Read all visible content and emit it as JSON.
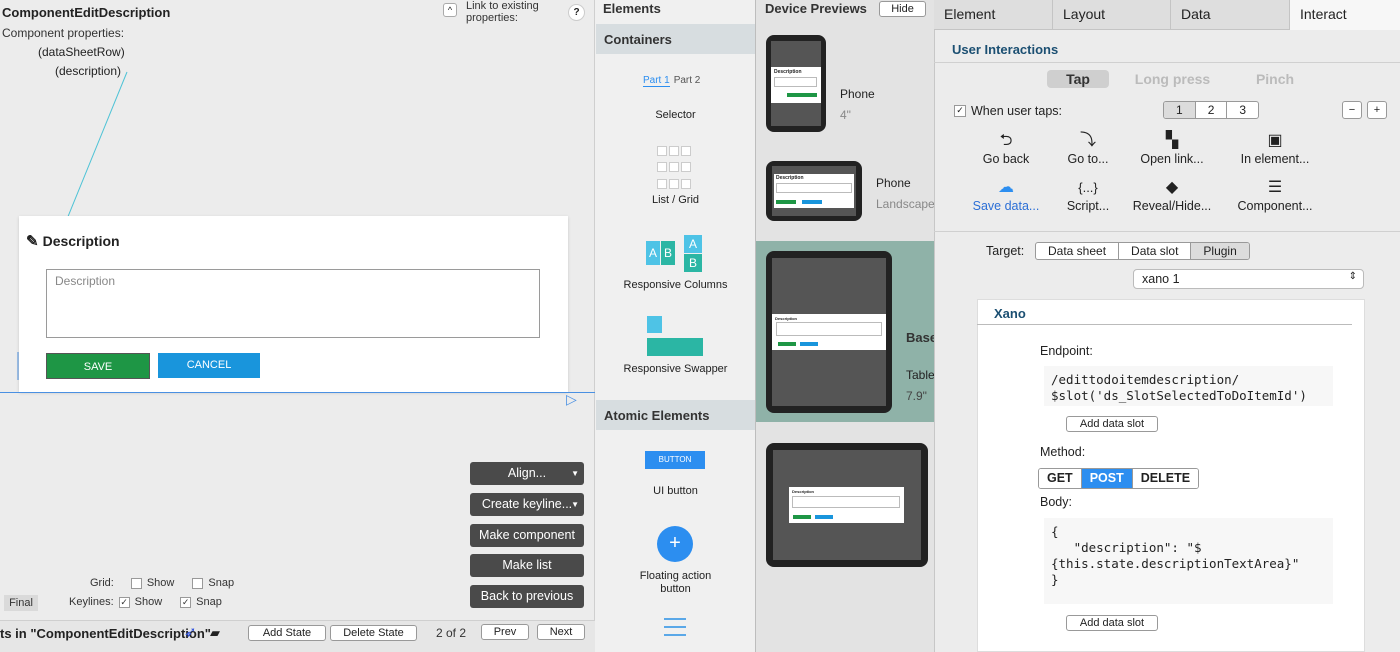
{
  "canvas": {
    "component_title": "ComponentEditDescription",
    "props_label": "Component properties:",
    "prop_lines": [
      "(dataSheetRow)",
      "(description)"
    ],
    "link_label": "Link to existing properties:",
    "help": "?",
    "card": {
      "title": "Description",
      "textarea_placeholder": "Description",
      "save_label": "SAVE",
      "cancel_label": "CANCEL"
    },
    "actions": [
      "Align...",
      "Create keyline...",
      "Make component",
      "Make list",
      "Back to previous"
    ],
    "grid_label": "Grid:",
    "keylines_label": "Keylines:",
    "show_label": "Show",
    "snap_label": "Snap",
    "final_label": "Final",
    "states_label": "ts in \"ComponentEditDescription\"",
    "add_state": "Add State",
    "delete_state": "Delete State",
    "page_indicator": "2 of 2",
    "prev": "Prev",
    "next": "Next"
  },
  "elements": {
    "header": "Elements",
    "containers_label": "Containers",
    "selector_part1": "Part 1",
    "selector_part2": "Part 2",
    "selector_label": "Selector",
    "list_grid_label": "List / Grid",
    "responsive_columns_label": "Responsive Columns",
    "responsive_swapper_label": "Responsive Swapper",
    "atomic_label": "Atomic Elements",
    "button_text": "BUTTON",
    "ui_button_label": "UI button",
    "fab_label": "Floating action button"
  },
  "devices": {
    "header": "Device Previews",
    "hide": "Hide",
    "items": [
      {
        "name": "Phone",
        "sub": "4\""
      },
      {
        "name": "Phone",
        "sub": "Landscape"
      },
      {
        "name": "Base",
        "sub": "Table",
        "sub2": "7.9\""
      },
      {
        "name": "",
        "sub": ""
      }
    ],
    "preview_title": "Description"
  },
  "right": {
    "tabs": [
      "Element",
      "Layout",
      "Data",
      "Interact"
    ],
    "active_tab": "Interact",
    "section_title": "User Interactions",
    "gesture_tabs": [
      "Tap",
      "Long press",
      "Pinch"
    ],
    "when_label": "When user taps:",
    "tap_counts": [
      "1",
      "2",
      "3"
    ],
    "minus": "−",
    "plus": "+",
    "actions_row1": [
      {
        "label": "Go back",
        "icon": "back-arrow-icon",
        "glyph": "⮌"
      },
      {
        "label": "Go to...",
        "icon": "goto-arrow-icon",
        "glyph": "⤵"
      },
      {
        "label": "Open link...",
        "icon": "open-link-icon",
        "glyph": "▚"
      },
      {
        "label": "In element...",
        "icon": "in-element-icon",
        "glyph": "▣"
      }
    ],
    "actions_row2": [
      {
        "label": "Save data...",
        "icon": "cloud-upload-icon",
        "glyph": "☁"
      },
      {
        "label": "Script...",
        "icon": "script-braces-icon",
        "glyph": "{...}"
      },
      {
        "label": "Reveal/Hide...",
        "icon": "reveal-diamond-icon",
        "glyph": "◆"
      },
      {
        "label": "Component...",
        "icon": "component-list-icon",
        "glyph": "☰"
      }
    ],
    "target_label": "Target:",
    "targets": [
      "Data sheet",
      "Data slot",
      "Plugin"
    ],
    "selected_target": "Plugin",
    "plugin_value": "xano 1",
    "xano": {
      "title": "Xano",
      "endpoint_label": "Endpoint:",
      "endpoint_line1": "/edittodoitemdescription/",
      "endpoint_line2": "$slot('ds_SlotSelectedToDoItemId')",
      "add_data_slot": "Add data slot",
      "method_label": "Method:",
      "methods": [
        "GET",
        "POST",
        "DELETE"
      ],
      "selected_method": "POST",
      "body_label": "Body:",
      "body_line1": "{",
      "body_line2": "   \"description\": \"$",
      "body_line3": "{this.state.descriptionTextArea}\"",
      "body_line4": "}"
    },
    "accent_color": "#2c8ef0"
  }
}
